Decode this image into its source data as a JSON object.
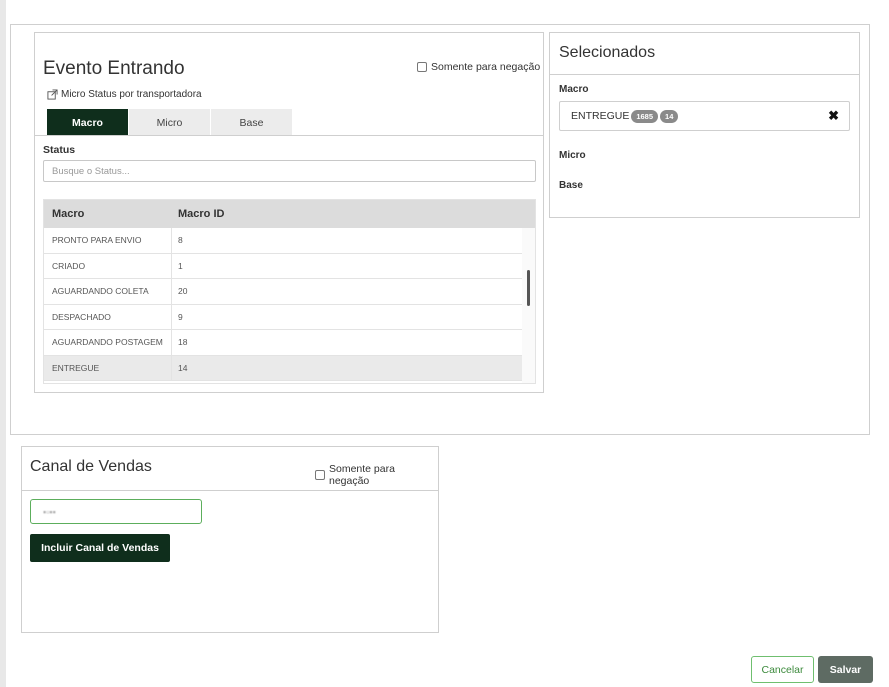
{
  "evento": {
    "title": "Evento Entrando",
    "negacao_label": "Somente para negação",
    "link_label": "Micro Status por transportadora",
    "tabs": [
      "Macro",
      "Micro",
      "Base"
    ],
    "status_label": "Status",
    "search_placeholder": "Busque o Status...",
    "table": {
      "headers": [
        "Macro",
        "Macro ID"
      ],
      "rows": [
        {
          "macro": "PRONTO PARA ENVIO",
          "id": "8"
        },
        {
          "macro": "CRIADO",
          "id": "1"
        },
        {
          "macro": "AGUARDANDO COLETA",
          "id": "20"
        },
        {
          "macro": "DESPACHADO",
          "id": "9"
        },
        {
          "macro": "AGUARDANDO POSTAGEM",
          "id": "18"
        },
        {
          "macro": "ENTREGUE",
          "id": "14"
        }
      ]
    }
  },
  "selecionados": {
    "title": "Selecionados",
    "macro_label": "Macro",
    "item": {
      "name": "ENTREGUE",
      "badge1": "1685",
      "badge2": "14",
      "remove": "✖"
    },
    "micro_label": "Micro",
    "base_label": "Base"
  },
  "canal": {
    "title": "Canal de Vendas",
    "negacao_label": "Somente para negação",
    "input_value": "▪▫▪▪",
    "button_label": "Incluir Canal de Vendas"
  },
  "footer": {
    "cancel_label": "Cancelar",
    "save_label": "Salvar"
  },
  "colors": {
    "dark_green": "#0f2e1c",
    "accent_green": "#5cae5c",
    "save_gray": "#5e6b63"
  }
}
